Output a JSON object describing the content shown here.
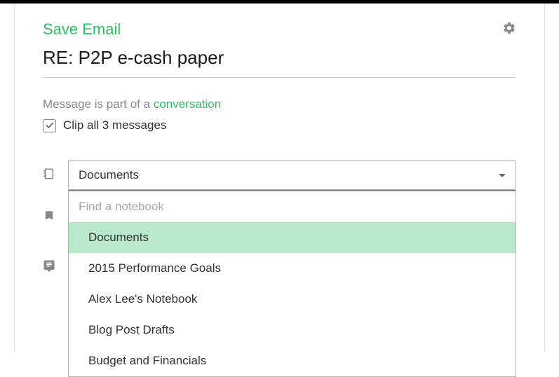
{
  "header": {
    "title": "Save Email"
  },
  "subject": "RE: P2P e-cash paper",
  "conversation": {
    "prefix": "Message is part of a ",
    "link": "conversation"
  },
  "clip": {
    "label": "Clip all 3 messages"
  },
  "notebook": {
    "selected": "Documents",
    "search_placeholder": "Find a notebook",
    "options": [
      "Documents",
      "2015 Performance Goals",
      "Alex Lee's Notebook",
      "Blog Post Drafts",
      "Budget and Financials"
    ]
  }
}
